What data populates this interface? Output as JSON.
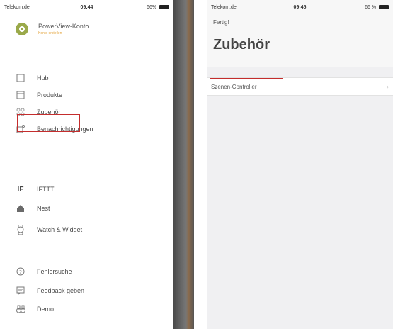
{
  "left_screen": {
    "status": {
      "carrier": "Telekom.de",
      "time": "09:44",
      "right": "66%"
    },
    "account": {
      "title": "PowerView-Konto",
      "subtitle": "Konto erstellen"
    },
    "menu_groups": [
      [
        {
          "icon": "square-icon",
          "label": "Hub"
        },
        {
          "icon": "product-icon",
          "label": "Produkte"
        },
        {
          "icon": "accessory-grid-icon",
          "label": "Zubehör"
        },
        {
          "icon": "notification-icon",
          "label": "Benachrichtigungen"
        }
      ],
      [
        {
          "icon": "ifttt-icon",
          "label": "IFTTT"
        },
        {
          "icon": "home-icon",
          "label": "Nest"
        },
        {
          "icon": "watch-icon",
          "label": "Watch & Widget"
        }
      ],
      [
        {
          "icon": "help-icon",
          "label": "Fehlersuche"
        },
        {
          "icon": "feedback-icon",
          "label": "Feedback geben"
        },
        {
          "icon": "binoculars-icon",
          "label": "Demo"
        }
      ]
    ],
    "ifttt_glyph": "IF"
  },
  "right_screen": {
    "status": {
      "carrier": "Telekom.de",
      "time": "09:45",
      "right": "66 %"
    },
    "nav_back": "Fertig!",
    "title": "Zubehör",
    "rows": [
      {
        "label": "Szenen-Controller"
      }
    ],
    "chevron": "›"
  },
  "colors": {
    "highlight": "#c42d2d",
    "brand_green": "#9aa94a",
    "account_sub": "#e3a33a"
  }
}
